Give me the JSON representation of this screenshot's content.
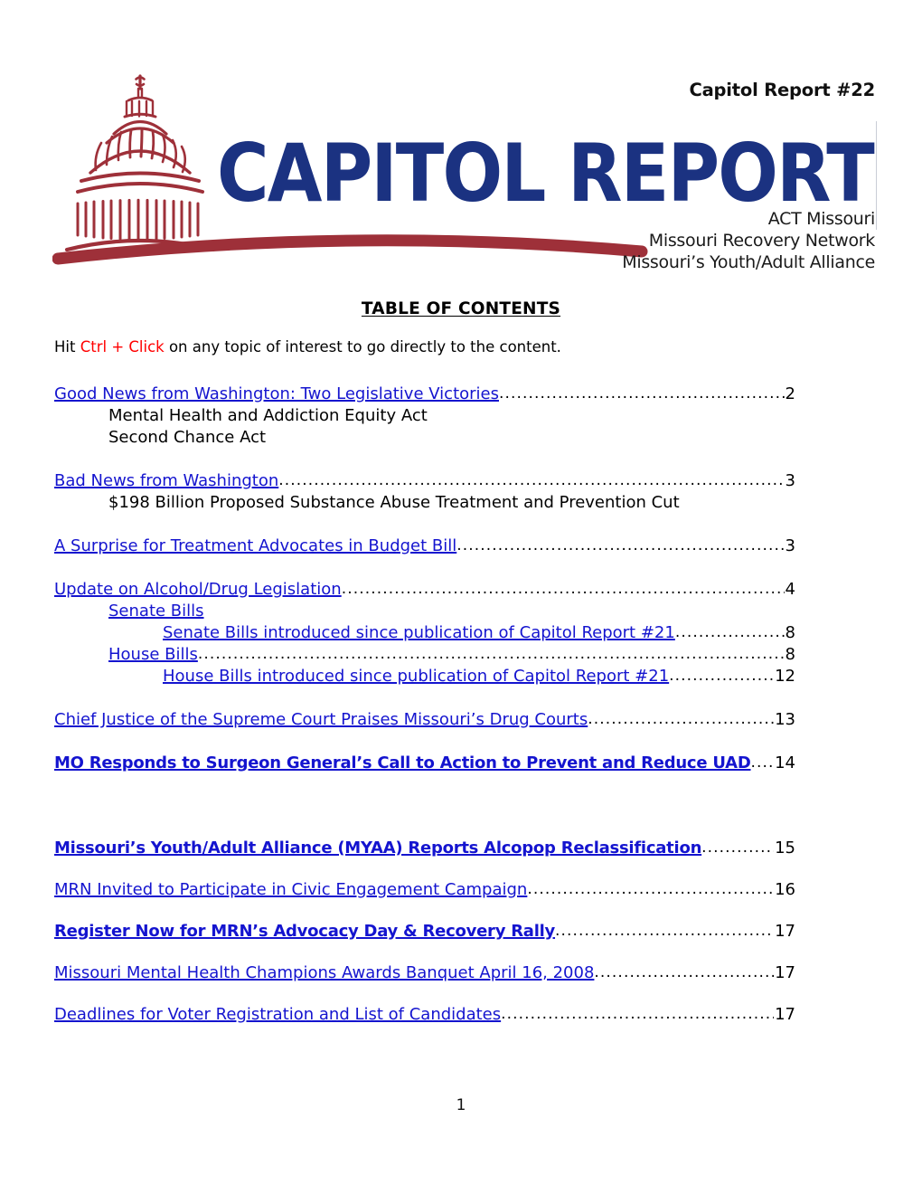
{
  "document": {
    "issue_label": "Capitol Report #22",
    "wordmark": "CAPITOL REPORT",
    "organizations": [
      "ACT Missouri",
      "Missouri Recovery Network",
      "Missouri’s Youth/Adult Alliance"
    ],
    "page_number": "1"
  },
  "colors": {
    "wordmark_blue": "#1B3281",
    "dome_maroon": "#9E3039",
    "link_blue": "#1414CF",
    "alert_red": "#FF0000",
    "text_black": "#000000"
  },
  "toc": {
    "heading": "TABLE OF CONTENTS",
    "hint_prefix": "Hit ",
    "hint_keys": "Ctrl + Click",
    "hint_suffix": " on any topic of interest to go directly to the content.",
    "entries": [
      {
        "label": "Good News from Washington:  Two Legislative Victories",
        "page": "2",
        "level": 0,
        "link": true,
        "bold": false,
        "leader": true
      },
      {
        "label": "Mental Health and Addiction Equity Act",
        "page": "",
        "level": 1,
        "link": false,
        "bold": false,
        "leader": false
      },
      {
        "label": "Second Chance Act",
        "page": "",
        "level": 1,
        "link": false,
        "bold": false,
        "leader": false
      },
      {
        "label": "Bad News from Washington",
        "page": "3",
        "level": 0,
        "link": true,
        "bold": false,
        "leader": true
      },
      {
        "label": "$198 Billion Proposed Substance Abuse Treatment and Prevention Cut",
        "page": "",
        "level": 1,
        "link": false,
        "bold": false,
        "leader": false
      },
      {
        "label": "A Surprise for Treatment Advocates in Budget Bill",
        "page": "3",
        "level": 0,
        "link": true,
        "bold": false,
        "leader": true
      },
      {
        "label": "Update on Alcohol/Drug Legislation",
        "page": "4",
        "level": 0,
        "link": true,
        "bold": false,
        "leader": true
      },
      {
        "label": "Senate Bills",
        "page": "",
        "level": 1,
        "link": true,
        "bold": false,
        "leader": false
      },
      {
        "label": "Senate Bills introduced since publication of Capitol Report #21",
        "page": "8",
        "level": 2,
        "link": true,
        "bold": false,
        "leader": true
      },
      {
        "label": "House Bills",
        "page": "8",
        "level": 1,
        "link": true,
        "bold": false,
        "leader": true
      },
      {
        "label": "House Bills introduced since publication of Capitol Report #21",
        "page": "12",
        "level": 2,
        "link": true,
        "bold": false,
        "leader": true
      },
      {
        "label": "Chief Justice of the Supreme Court Praises Missouri’s Drug Courts",
        "page": "13",
        "level": 0,
        "link": true,
        "bold": false,
        "leader": true
      },
      {
        "label": "MO Responds to Surgeon General’s Call to Action to Prevent and Reduce UAD",
        "page": "14",
        "level": 0,
        "link": true,
        "bold": true,
        "leader": true
      },
      {
        "label": "Missouri’s Youth/Adult Alliance (MYAA) Reports Alcopop Reclassification",
        "page": "15",
        "level": 0,
        "link": true,
        "bold": true,
        "leader": true
      },
      {
        "label": "MRN Invited to Participate in Civic Engagement Campaign",
        "page": "16",
        "level": 0,
        "link": true,
        "bold": false,
        "leader": true
      },
      {
        "label": "Register Now for MRN’s Advocacy Day & Recovery Rally",
        "page": "17",
        "level": 0,
        "link": true,
        "bold": true,
        "leader": true
      },
      {
        "label": "Missouri Mental Health Champions Awards Banquet April 16, 2008",
        "page": "17",
        "level": 0,
        "link": true,
        "bold": false,
        "leader": true
      },
      {
        "label": "Deadlines for Voter Registration and List of Candidates",
        "page": "17",
        "level": 0,
        "link": true,
        "bold": false,
        "leader": true
      }
    ]
  }
}
